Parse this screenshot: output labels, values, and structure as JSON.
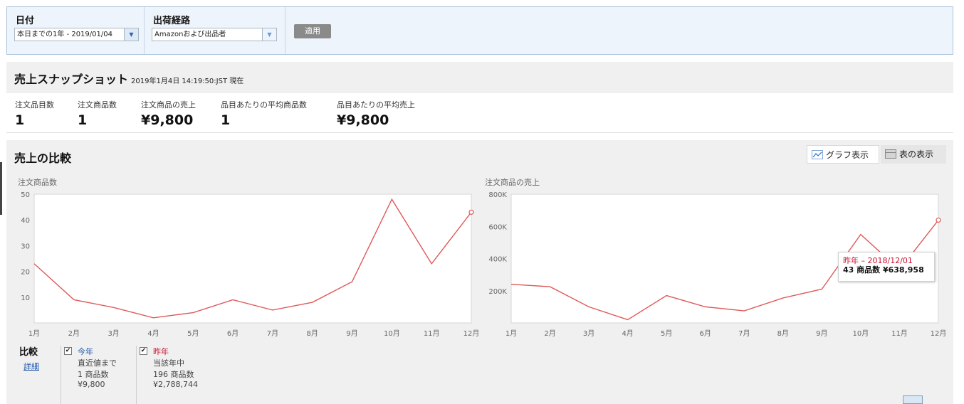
{
  "filters": {
    "date": {
      "label": "日付",
      "value": "本日までの1年 - 2019/01/04"
    },
    "channel": {
      "label": "出荷経路",
      "value": "Amazonおよび出品者"
    },
    "apply_label": "適用"
  },
  "snapshot": {
    "title": "売上スナップショット",
    "timestamp": "2019年1月4日 14:19:50:JST 現在",
    "metrics": [
      {
        "label": "注文品目数",
        "value": "1"
      },
      {
        "label": "注文商品数",
        "value": "1"
      },
      {
        "label": "注文商品の売上",
        "value": "¥9,800"
      },
      {
        "label": "品目あたりの平均商品数",
        "value": "1"
      },
      {
        "label": "品目あたりの平均売上",
        "value": "¥9,800"
      }
    ]
  },
  "compare": {
    "title": "売上の比較",
    "graph_view_label": "グラフ表示",
    "table_view_label": "表の表示",
    "section_label": "比較",
    "detail_link": "詳細",
    "this_year": {
      "name": "今年",
      "period": "直近値まで",
      "units": "1 商品数",
      "sales": "¥9,800",
      "color": "#1a56b0"
    },
    "last_year": {
      "name": "昨年",
      "period": "当該年中",
      "units": "196 商品数",
      "sales": "¥2,788,744",
      "color": "#c8102e"
    }
  },
  "tooltip": {
    "line1": "昨年 – 2018/12/01",
    "line2": "43 商品数 ¥638,958"
  },
  "colors": {
    "line": "#e05a5a",
    "accent": "#1a56b0",
    "last_year": "#c8102e"
  },
  "chart_data": [
    {
      "type": "line",
      "title": "注文商品数",
      "categories": [
        "1月",
        "2月",
        "3月",
        "4月",
        "5月",
        "6月",
        "7月",
        "8月",
        "9月",
        "10月",
        "11月",
        "12月"
      ],
      "ylim": [
        0,
        50
      ],
      "yticks": [
        10,
        20,
        30,
        40,
        50
      ],
      "ytick_labels": [
        "10",
        "20",
        "30",
        "40",
        "50"
      ],
      "series": [
        {
          "name": "昨年",
          "values": [
            23,
            9,
            6,
            2,
            4,
            9,
            5,
            8,
            16,
            48,
            23,
            43
          ]
        }
      ],
      "grid": false
    },
    {
      "type": "line",
      "title": "注文商品の売上",
      "categories": [
        "1月",
        "2月",
        "3月",
        "4月",
        "5月",
        "6月",
        "7月",
        "8月",
        "9月",
        "10月",
        "11月",
        "12月"
      ],
      "ylim": [
        0,
        800000
      ],
      "yticks": [
        200000,
        400000,
        600000,
        800000
      ],
      "ytick_labels": [
        "200K",
        "400K",
        "600K",
        "800K"
      ],
      "series": [
        {
          "name": "昨年",
          "values": [
            240000,
            225000,
            100000,
            20000,
            170000,
            100000,
            75000,
            155000,
            210000,
            550000,
            330000,
            638958
          ]
        }
      ],
      "grid": false
    }
  ]
}
